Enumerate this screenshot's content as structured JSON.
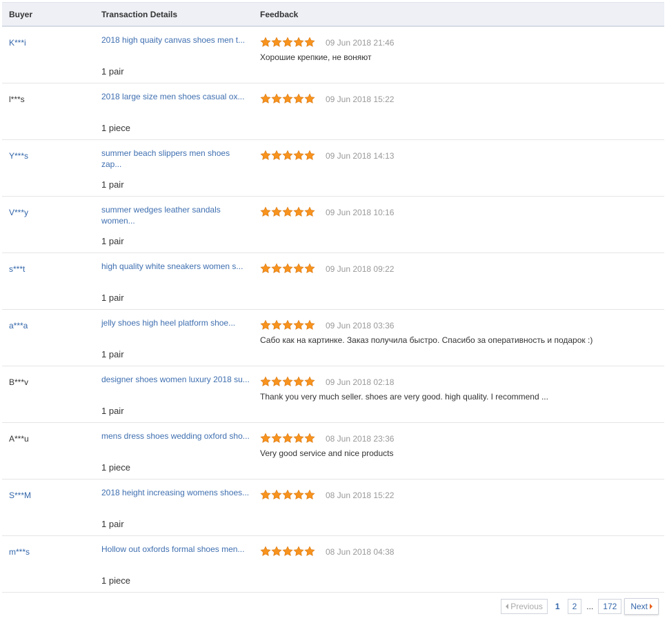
{
  "header": {
    "buyer": "Buyer",
    "details": "Transaction Details",
    "feedback": "Feedback"
  },
  "colors": {
    "star": "#f7931e",
    "link": "#3f6fb0",
    "date": "#999999",
    "header_bg": "#eef0f6",
    "next_arrow": "#e8611c"
  },
  "rows": [
    {
      "buyer": "K***i",
      "buyer_link": true,
      "product": "2018 high quaity canvas shoes men t...",
      "qty": "1 pair",
      "rating": 5,
      "date": "09 Jun 2018 21:46",
      "comment": "Хорошие крепкие, не воняют"
    },
    {
      "buyer": "l***s",
      "buyer_link": false,
      "product": "2018 large size men shoes casual ox...",
      "qty": "1 piece",
      "rating": 5,
      "date": "09 Jun 2018 15:22",
      "comment": ""
    },
    {
      "buyer": "Y***s",
      "buyer_link": true,
      "product": "summer beach slippers men shoes zap...",
      "qty": "1 pair",
      "rating": 5,
      "date": "09 Jun 2018 14:13",
      "comment": ""
    },
    {
      "buyer": "V***y",
      "buyer_link": true,
      "product": "summer wedges leather sandals women...",
      "qty": "1 pair",
      "rating": 5,
      "date": "09 Jun 2018 10:16",
      "comment": ""
    },
    {
      "buyer": "s***t",
      "buyer_link": true,
      "product": "high quality white sneakers women s...",
      "qty": "1 pair",
      "rating": 5,
      "date": "09 Jun 2018 09:22",
      "comment": ""
    },
    {
      "buyer": "a***a",
      "buyer_link": true,
      "product": "jelly shoes high heel platform shoe...",
      "qty": "1 pair",
      "rating": 5,
      "date": "09 Jun 2018 03:36",
      "comment": "Сабо как на картинке. Заказ получила быстро. Спасибо за оперативность и подарок :)"
    },
    {
      "buyer": "B***v",
      "buyer_link": false,
      "product": "designer shoes women luxury 2018 su...",
      "qty": "1 pair",
      "rating": 5,
      "date": "09 Jun 2018 02:18",
      "comment": "Thank you very much seller. shoes are very good. high quality. I recommend ..."
    },
    {
      "buyer": "A***u",
      "buyer_link": false,
      "product": "mens dress shoes wedding oxford sho...",
      "qty": "1 piece",
      "rating": 5,
      "date": "08 Jun 2018 23:36",
      "comment": "Very good service and nice products"
    },
    {
      "buyer": "S***M",
      "buyer_link": true,
      "product": "2018 height increasing womens shoes...",
      "qty": "1 pair",
      "rating": 5,
      "date": "08 Jun 2018 15:22",
      "comment": ""
    },
    {
      "buyer": "m***s",
      "buyer_link": true,
      "product": "Hollow out oxfords formal shoes men...",
      "qty": "1 piece",
      "rating": 5,
      "date": "08 Jun 2018 04:38",
      "comment": ""
    }
  ],
  "pager": {
    "previous": "Previous",
    "current": "1",
    "page2": "2",
    "ellipsis": "...",
    "last": "172",
    "next": "Next"
  }
}
